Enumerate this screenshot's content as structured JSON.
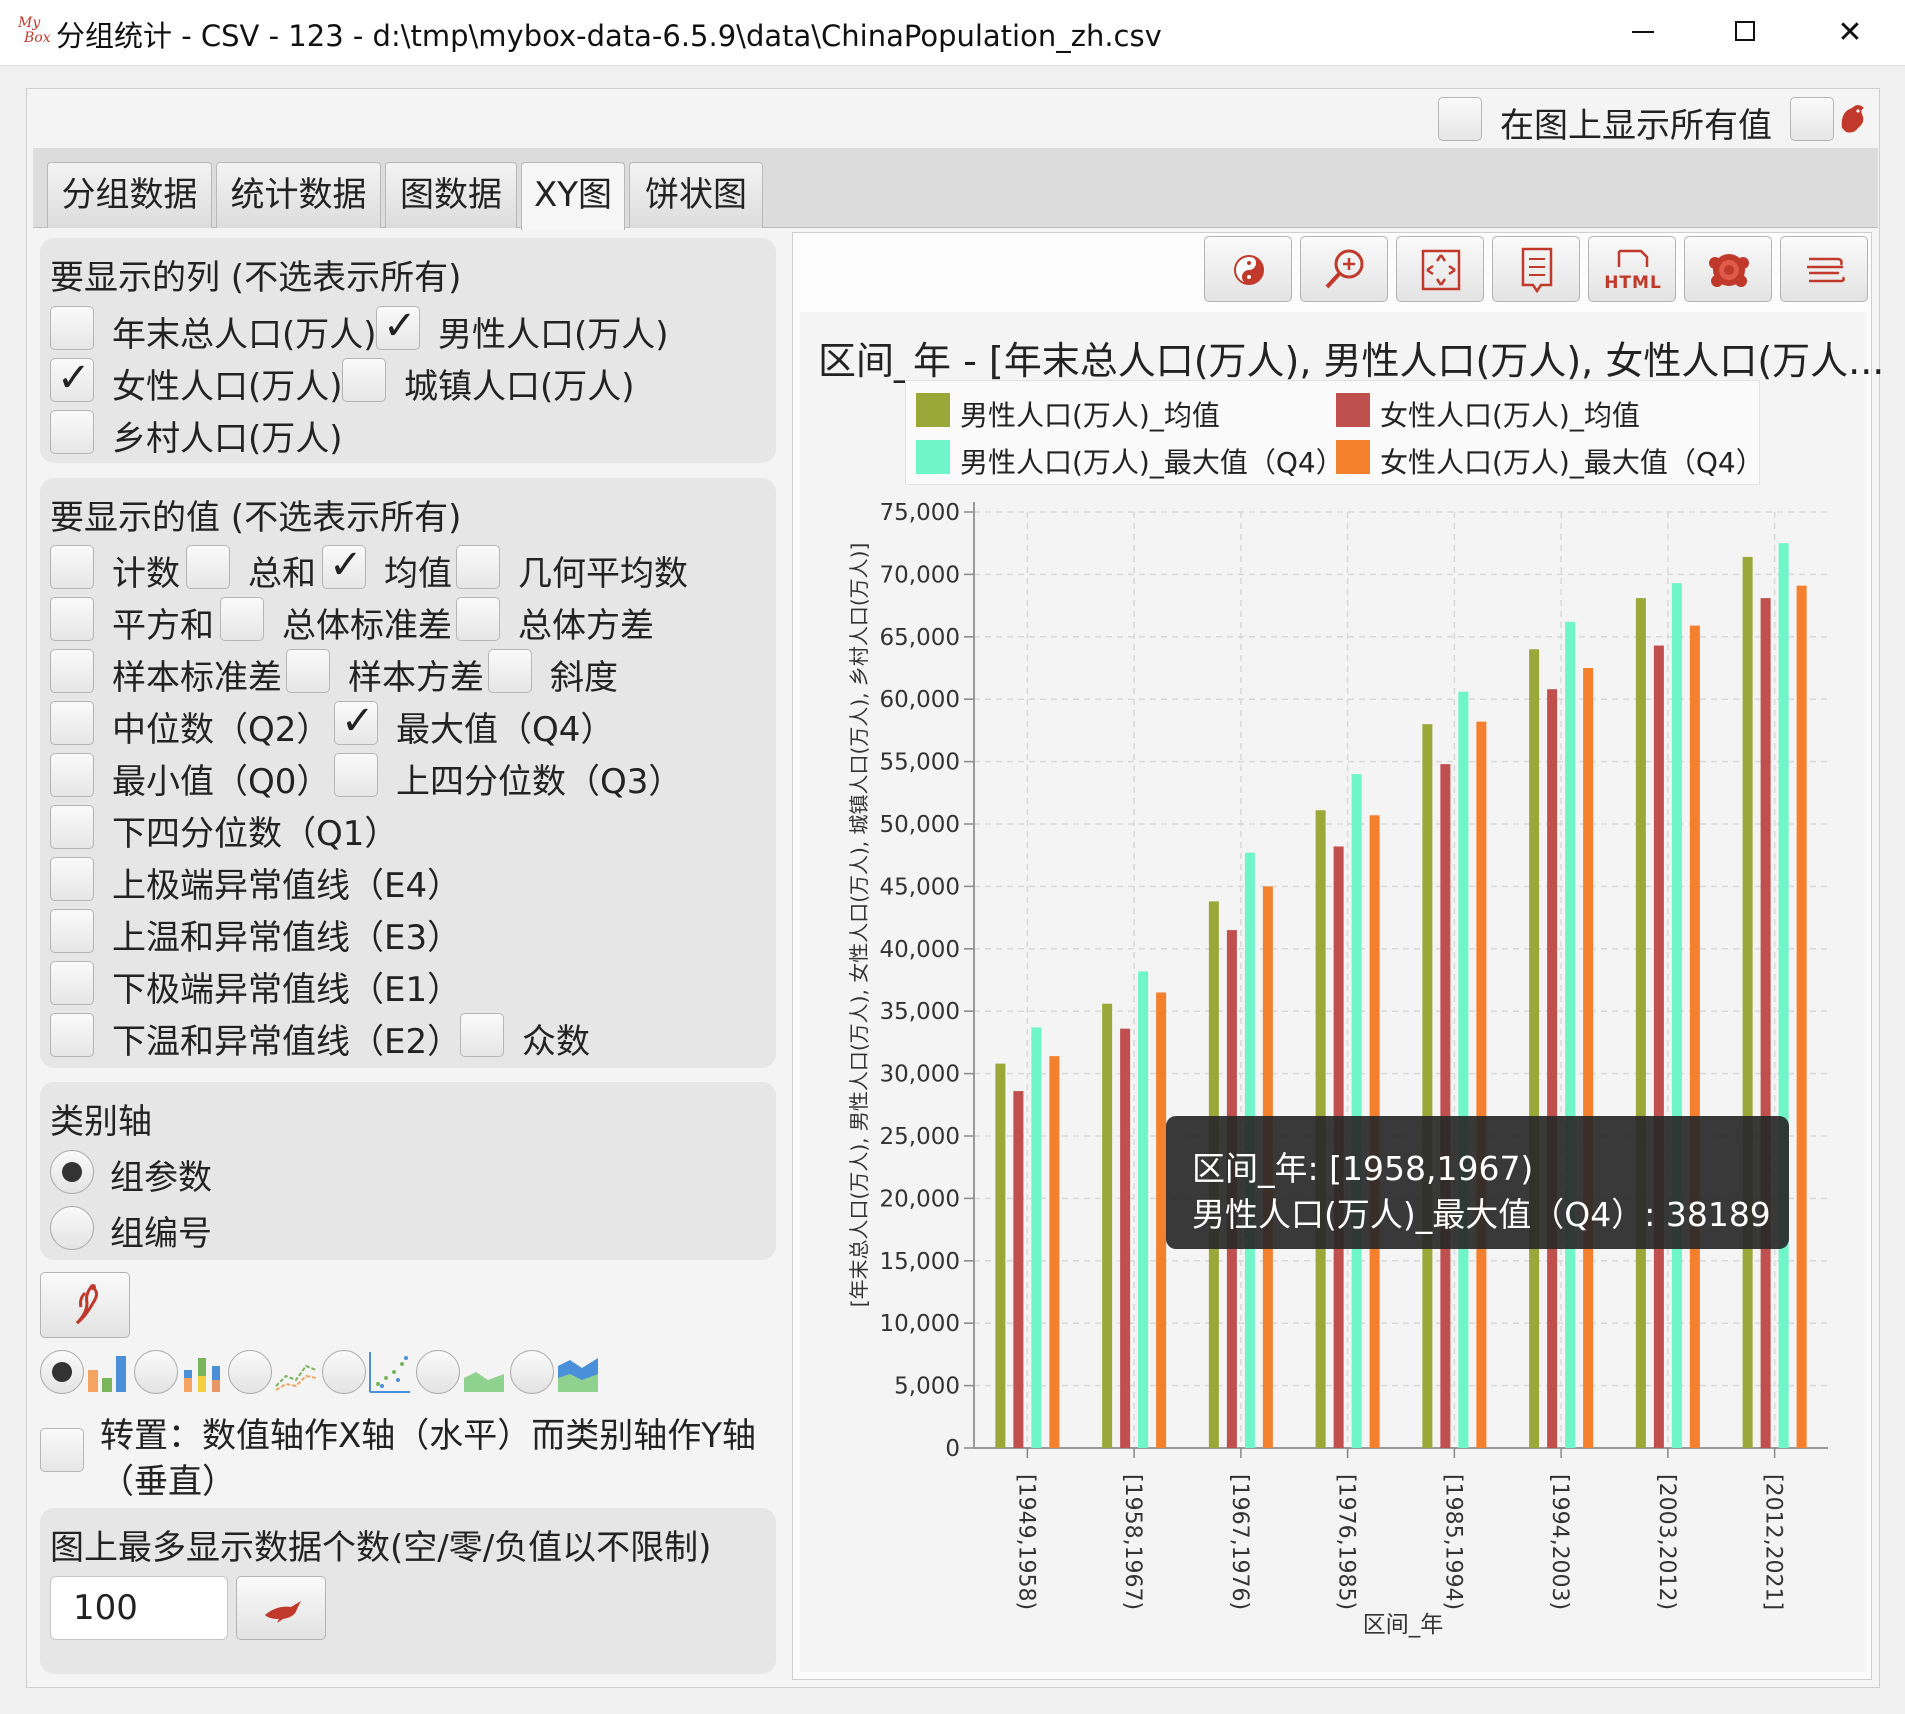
{
  "window": {
    "title": "分组统计 - CSV - 123 - d:\\tmp\\mybox-data-6.5.9\\data\\ChinaPopulation_zh.csv",
    "logo_top": "My",
    "logo_bottom": "Box",
    "close": "✕"
  },
  "top": {
    "show_all_values_label": "在图上显示所有值"
  },
  "tabs": [
    "分组数据",
    "统计数据",
    "图数据",
    "XY图",
    "饼状图"
  ],
  "active_tab": "XY图",
  "columns_section": {
    "title": "要显示的列 (不选表示所有)",
    "items": [
      {
        "label": "年末总人口(万人)",
        "checked": false
      },
      {
        "label": "男性人口(万人)",
        "checked": true
      },
      {
        "label": "女性人口(万人)",
        "checked": true
      },
      {
        "label": "城镇人口(万人)",
        "checked": false
      },
      {
        "label": "乡村人口(万人)",
        "checked": false
      }
    ]
  },
  "values_section": {
    "title": "要显示的值 (不选表示所有)",
    "items": [
      {
        "label": "计数",
        "checked": false
      },
      {
        "label": "总和",
        "checked": false
      },
      {
        "label": "均值",
        "checked": true
      },
      {
        "label": "几何平均数",
        "checked": false
      },
      {
        "label": "平方和",
        "checked": false
      },
      {
        "label": "总体标准差",
        "checked": false
      },
      {
        "label": "总体方差",
        "checked": false
      },
      {
        "label": "样本标准差",
        "checked": false
      },
      {
        "label": "样本方差",
        "checked": false
      },
      {
        "label": "斜度",
        "checked": false
      },
      {
        "label": "中位数（Q2）",
        "checked": false
      },
      {
        "label": "最大值（Q4）",
        "checked": true
      },
      {
        "label": "最小值（Q0）",
        "checked": false
      },
      {
        "label": "上四分位数（Q3）",
        "checked": false
      },
      {
        "label": "下四分位数（Q1）",
        "checked": false
      },
      {
        "label": "上极端异常值线（E4）",
        "checked": false
      },
      {
        "label": "上温和异常值线（E3）",
        "checked": false
      },
      {
        "label": "下极端异常值线（E1）",
        "checked": false
      },
      {
        "label": "下温和异常值线（E2）",
        "checked": false
      },
      {
        "label": "众数",
        "checked": false
      }
    ]
  },
  "category_axis": {
    "title": "类别轴",
    "options": [
      {
        "label": "组参数",
        "selected": true
      },
      {
        "label": "组编号",
        "selected": false
      }
    ]
  },
  "chart_types": [
    {
      "icon": "bar-chart-icon",
      "selected": true
    },
    {
      "icon": "stacked-bar-chart-icon",
      "selected": false
    },
    {
      "icon": "line-chart-icon",
      "selected": false
    },
    {
      "icon": "scatter-chart-icon",
      "selected": false
    },
    {
      "icon": "area-chart-icon",
      "selected": false
    },
    {
      "icon": "stacked-area-chart-icon",
      "selected": false
    }
  ],
  "transpose": {
    "label_line1": "转置：数值轴作X轴（水平）而类别轴作Y轴",
    "label_line2": "（垂直）",
    "checked": false
  },
  "max_data": {
    "title": "图上最多显示数据个数(空/零/负值以不限制)",
    "value": "100"
  },
  "toolbar": {
    "html_label": "HTML"
  },
  "tooltip": {
    "line1": "区间_年: [1958,1967)",
    "line2": "男性人口(万人)_最大值（Q4）: 38189"
  },
  "colors": {
    "series1": "#9aa83a",
    "series2": "#c0504d",
    "series3": "#6ef5c8",
    "series4": "#f47f2d",
    "accent_red": "#c0392b"
  },
  "chart_data": {
    "type": "bar",
    "title": "区间_年 - [年末总人口(万人), 男性人口(万人), 女性人口(万人...",
    "xlabel": "区间_年",
    "ylabel": "[年末总人口(万人), 男性人口(万人), 女性人口(万人), 城镇人口(万人), 乡村人口(万人)]",
    "ylim": [
      0,
      75000
    ],
    "yticks": [
      0,
      5000,
      10000,
      15000,
      20000,
      25000,
      30000,
      35000,
      40000,
      45000,
      50000,
      55000,
      60000,
      65000,
      70000,
      75000
    ],
    "ytick_labels": [
      "0",
      "5,000",
      "10,000",
      "15,000",
      "20,000",
      "25,000",
      "30,000",
      "35,000",
      "40,000",
      "45,000",
      "50,000",
      "55,000",
      "60,000",
      "65,000",
      "70,000",
      "75,000"
    ],
    "categories": [
      "[1949,1958)",
      "[1958,1967)",
      "[1967,1976)",
      "[1976,1985)",
      "[1985,1994)",
      "[1994,2003)",
      "[2003,2012)",
      "[2012,2021]"
    ],
    "legend_position": "top",
    "grid": true,
    "series": [
      {
        "name": "男性人口(万人)_均值",
        "color": "#9aa83a",
        "values": [
          30800,
          35600,
          43800,
          51100,
          58000,
          64000,
          68100,
          71400
        ]
      },
      {
        "name": "女性人口(万人)_均值",
        "color": "#c0504d",
        "values": [
          28600,
          33600,
          41500,
          48200,
          54800,
          60800,
          64300,
          68100
        ]
      },
      {
        "name": "男性人口(万人)_最大值（Q4）",
        "color": "#6ef5c8",
        "values": [
          33700,
          38189,
          47700,
          54000,
          60600,
          66200,
          69300,
          72500
        ]
      },
      {
        "name": "女性人口(万人)_最大值（Q4）",
        "color": "#f47f2d",
        "values": [
          31400,
          36500,
          45000,
          50700,
          58200,
          62500,
          65900,
          69100
        ]
      }
    ]
  }
}
